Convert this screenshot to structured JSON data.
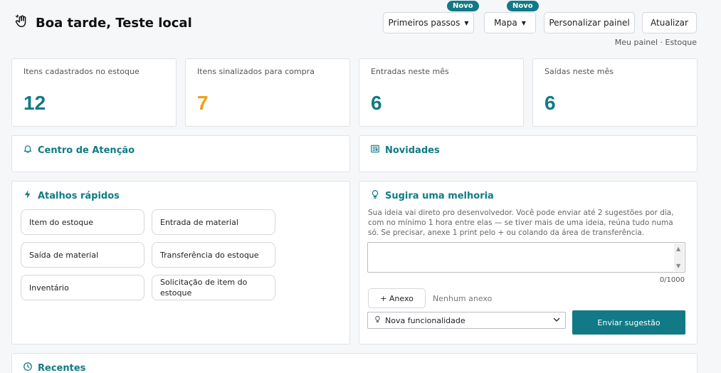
{
  "header": {
    "title": "Boa tarde, Teste local",
    "buttons": {
      "primeiros_passos": "Primeiros passos",
      "mapa": "Mapa",
      "personalizar": "Personalizar painel",
      "atualizar": "Atualizar"
    },
    "badge_new": "Novo",
    "breadcrumb": "Meu painel · Estoque"
  },
  "stats": [
    {
      "label": "Itens cadastrados no estoque",
      "value": "12",
      "color": "#117a86"
    },
    {
      "label": "Itens sinalizados para compra",
      "value": "7",
      "color": "#e8a21c"
    },
    {
      "label": "Entradas neste mês",
      "value": "6",
      "color": "#117a86"
    },
    {
      "label": "Saídas neste mês",
      "value": "6",
      "color": "#117a86"
    }
  ],
  "sections": {
    "attention": "Centro de Atenção",
    "news": "Novidades",
    "shortcuts": "Atalhos rápidos",
    "suggest": "Sugira uma melhoria",
    "recent": "Recentes"
  },
  "shortcuts": [
    "Item do estoque",
    "Entrada de material",
    "Saída de material",
    "Transferência do estoque",
    "Inventário",
    "Solicitação de item do estoque"
  ],
  "suggestion": {
    "hint": "Sua ideia vai direto pro desenvolvedor. Você pode enviar até 2 sugestões por dia, com no mínimo 1 hora entre elas — se tiver mais de uma ideia, reúna tudo numa só. Se precisar, anexe 1 print pelo + ou colando da área de transferência.",
    "counter": "0/1000",
    "attach_label": "+ Anexo",
    "no_attachment": "Nenhum anexo",
    "type_selected": "Nova funcionalidade",
    "submit_label": "Enviar sugestão"
  },
  "colors": {
    "accent": "#117a86",
    "warning": "#e8a21c"
  }
}
